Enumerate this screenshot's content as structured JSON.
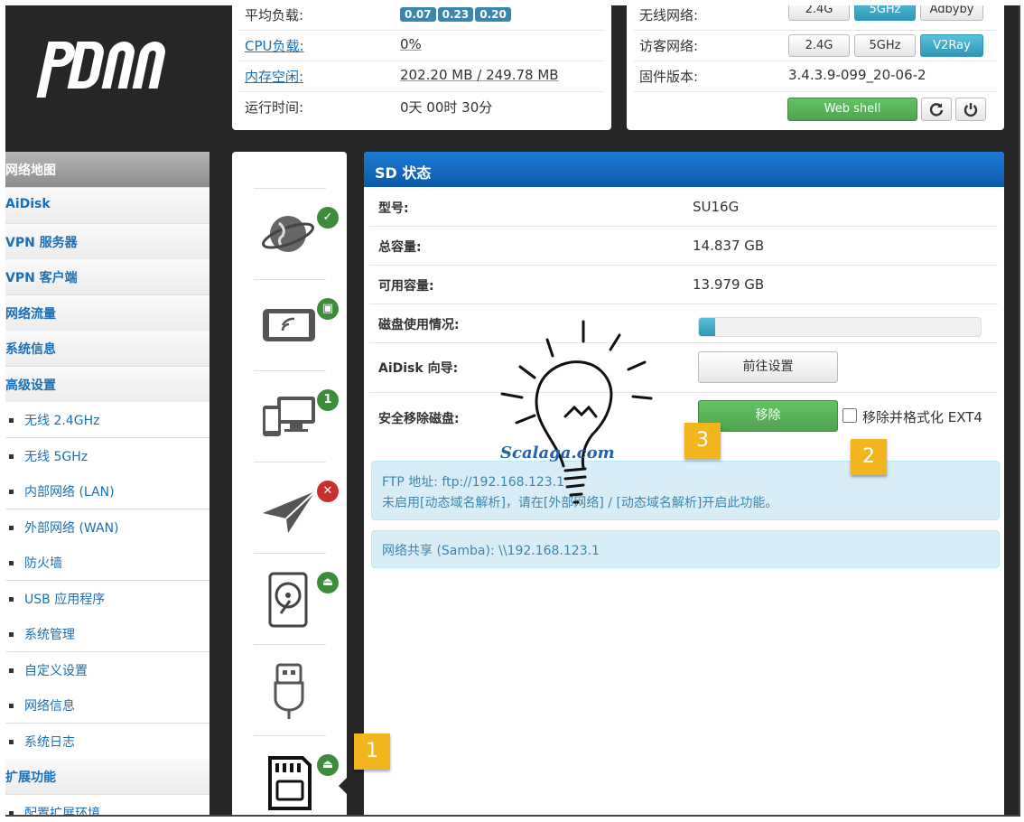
{
  "app": {
    "logo_text": "padavan"
  },
  "status_left": {
    "rows": [
      {
        "label": "平均负载:",
        "loads": [
          "0.07",
          "0.23",
          "0.20"
        ]
      },
      {
        "label": "CPU负载:",
        "value": "0%"
      },
      {
        "label": "内存空闲:",
        "value": "202.20 MB / 249.78 MB"
      },
      {
        "label": "运行时间:",
        "value": "0天 00时 30分"
      }
    ]
  },
  "status_right": {
    "wireless": {
      "label": "无线网络:",
      "buttons": [
        "2.4G",
        "5GHz",
        "Adbyby"
      ],
      "active": "5GHz"
    },
    "guest": {
      "label": "访客网络:",
      "buttons": [
        "2.4G",
        "5GHz",
        "V2Ray"
      ],
      "active": "V2Ray"
    },
    "firmware": {
      "label": "固件版本:",
      "value": "3.4.3.9-099_20-06-2"
    },
    "web_shell_label": "Web shell",
    "refresh_icon": "refresh-icon",
    "power_icon": "power-icon"
  },
  "sidebar": {
    "items": [
      {
        "label": "网络地图",
        "type": "head"
      },
      {
        "label": "AiDisk",
        "type": "top"
      },
      {
        "label": "VPN 服务器",
        "type": "top"
      },
      {
        "label": "VPN 客户端",
        "type": "top"
      },
      {
        "label": "网络流量",
        "type": "top"
      },
      {
        "label": "系统信息",
        "type": "top"
      },
      {
        "label": "高级设置",
        "type": "top"
      },
      {
        "label": "无线 2.4GHz",
        "type": "sub"
      },
      {
        "label": "无线 5GHz",
        "type": "sub"
      },
      {
        "label": "内部网络 (LAN)",
        "type": "sub"
      },
      {
        "label": "外部网络 (WAN)",
        "type": "sub"
      },
      {
        "label": "防火墙",
        "type": "sub"
      },
      {
        "label": "USB 应用程序",
        "type": "sub"
      },
      {
        "label": "系统管理",
        "type": "sub"
      },
      {
        "label": "自定义设置",
        "type": "sub"
      },
      {
        "label": "网络信息",
        "type": "sub"
      },
      {
        "label": "系统日志",
        "type": "sub"
      },
      {
        "label": "扩展功能",
        "type": "top"
      },
      {
        "label": "配置扩展环境",
        "type": "sub"
      }
    ]
  },
  "icon_column": {
    "items": [
      {
        "icon": "internet-globe-icon",
        "status": "check"
      },
      {
        "icon": "wireless-device-icon",
        "status": "lock"
      },
      {
        "icon": "clients-icon",
        "status": "1"
      },
      {
        "icon": "vpn-plane-icon",
        "status": "x"
      },
      {
        "icon": "hard-disk-icon",
        "status": "eject"
      },
      {
        "icon": "usb-icon",
        "status": ""
      },
      {
        "icon": "sd-card-icon",
        "status": "eject"
      }
    ]
  },
  "sd_panel": {
    "title": "SD 状态",
    "rows": [
      {
        "key": "型号:",
        "value": "SU16G"
      },
      {
        "key": "总容量:",
        "value": "14.837 GB"
      },
      {
        "key": "可用容量:",
        "value": "13.979 GB"
      },
      {
        "key": "磁盘使用情况:",
        "usage_fraction": 0.058
      },
      {
        "key": "AiDisk 向导:",
        "button": "前往设置"
      },
      {
        "key": "安全移除磁盘:",
        "button": "移除",
        "checkbox_label": "移除并格式化 EXT4"
      }
    ],
    "ftp_line1": "FTP 地址: ftp://192.168.123.1",
    "ftp_line2": "未启用[动态域名解析]，请在[外部网络] / [动态域名解析]开启此功能。",
    "samba": "网络共享 (Samba): \\\\192.168.123.1"
  },
  "callouts": [
    "1",
    "2",
    "3"
  ],
  "watermark": "Scalaga.com",
  "colors": {
    "accent": "#1a6fb5",
    "header": "#0b5aa8",
    "green": "#51a351",
    "callout": "#f3b51d"
  }
}
